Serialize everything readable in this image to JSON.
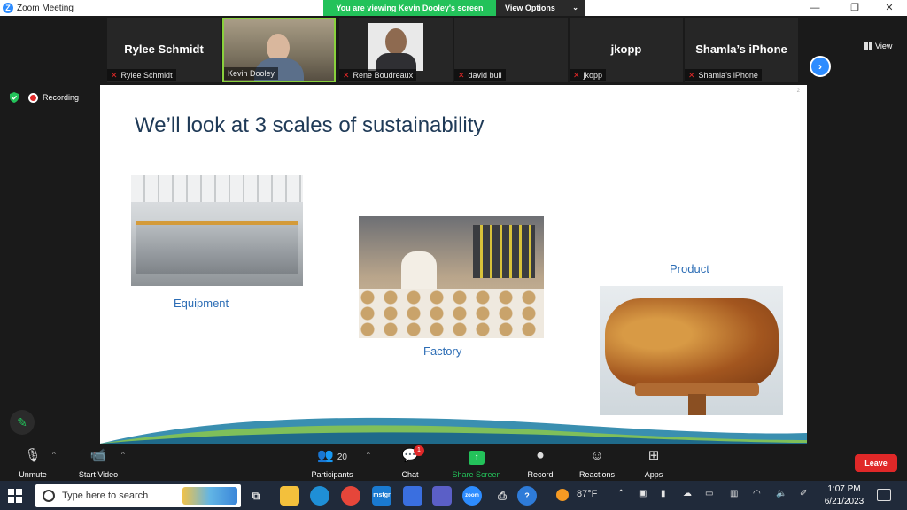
{
  "window": {
    "title": "Zoom Meeting",
    "logo_letter": "Z",
    "controls": {
      "minimize": "—",
      "maximize": "❐",
      "close": "✕"
    }
  },
  "share_banner": {
    "viewing_text": "You are viewing Kevin Dooley's screen",
    "options_label": "View Options",
    "options_chevron": "⌄"
  },
  "gallery": {
    "tiles": [
      {
        "big_name": "Rylee Schmidt",
        "tag": "Rylee Schmidt",
        "muted": true
      },
      {
        "big_name": "",
        "tag": "Kevin Dooley",
        "muted": false,
        "active": true
      },
      {
        "big_name": "",
        "tag": "Rene Boudreaux",
        "muted": true
      },
      {
        "big_name": "",
        "tag": "david bull",
        "muted": true
      },
      {
        "big_name": "jkopp",
        "tag": "jkopp",
        "muted": true
      },
      {
        "big_name": "Shamla’s iPhone",
        "tag": "Shamla’s iPhone",
        "muted": true
      }
    ],
    "next_arrow": "›",
    "view_label": "View"
  },
  "recording": {
    "label": "Recording"
  },
  "slide": {
    "page_number": "2",
    "heading": "We’ll look at 3 scales of sustainability",
    "captions": {
      "equipment": "Equipment",
      "factory": "Factory",
      "product": "Product"
    }
  },
  "toolbar": {
    "unmute": "Unmute",
    "start_video": "Start Video",
    "participants_label": "Participants",
    "participants_count": "20",
    "chat_label": "Chat",
    "chat_badge": "1",
    "share_screen": "Share Screen",
    "record": "Record",
    "reactions": "Reactions",
    "apps": "Apps",
    "leave": "Leave",
    "caret": "^"
  },
  "taskbar": {
    "search_placeholder": "Type here to search",
    "weather": "87°F",
    "time": "1:07 PM",
    "date": "6/21/2023",
    "apps": [
      "zoom",
      "mstgr"
    ]
  },
  "colors": {
    "zoom_blue": "#2d8cff",
    "share_green": "#23c25a",
    "muted_red": "#e02828",
    "slide_heading": "#1f3a57",
    "slide_caption": "#2c6db5"
  }
}
